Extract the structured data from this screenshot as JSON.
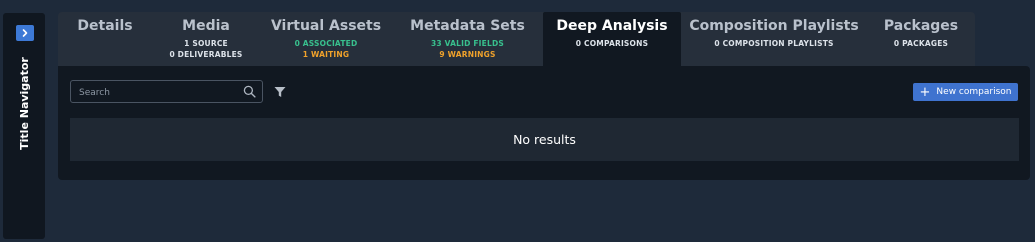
{
  "navigator": {
    "label": "Title Navigator",
    "toggle_icon": "chevron-right-icon",
    "toggle_glyph": "›"
  },
  "tabs": [
    {
      "title": "Details",
      "lines": [],
      "active": false
    },
    {
      "title": "Media",
      "lines": [
        {
          "text": "1 SOURCE",
          "color": "white"
        },
        {
          "text": "0 DELIVERABLES",
          "color": "white"
        }
      ],
      "active": false
    },
    {
      "title": "Virtual Assets",
      "lines": [
        {
          "text": "0 ASSOCIATED",
          "color": "green"
        },
        {
          "text": "1 WAITING",
          "color": "orange"
        }
      ],
      "active": false
    },
    {
      "title": "Metadata Sets",
      "lines": [
        {
          "text": "33 VALID FIELDS",
          "color": "green"
        },
        {
          "text": "9 WARNINGS",
          "color": "orange"
        }
      ],
      "active": false
    },
    {
      "title": "Deep Analysis",
      "lines": [
        {
          "text": "0 COMPARISONS",
          "color": "white"
        }
      ],
      "active": true
    },
    {
      "title": "Composition Playlists",
      "lines": [
        {
          "text": "0 COMPOSITION PLAYLISTS",
          "color": "white"
        }
      ],
      "active": false
    },
    {
      "title": "Packages",
      "lines": [
        {
          "text": "0 PACKAGES",
          "color": "white"
        }
      ],
      "active": false
    }
  ],
  "toolbar": {
    "search_placeholder": "Search",
    "search_value": "",
    "search_icon": "search-icon",
    "filter_icon": "filter-icon",
    "new_button_label": "New comparison",
    "new_button_icon": "plus-icon"
  },
  "results": {
    "empty_text": "No results"
  },
  "colors": {
    "accent": "#3f73cf",
    "green": "#38c18e",
    "orange": "#f0a22b",
    "background": "#1e2a3a",
    "panel": "#111821"
  }
}
